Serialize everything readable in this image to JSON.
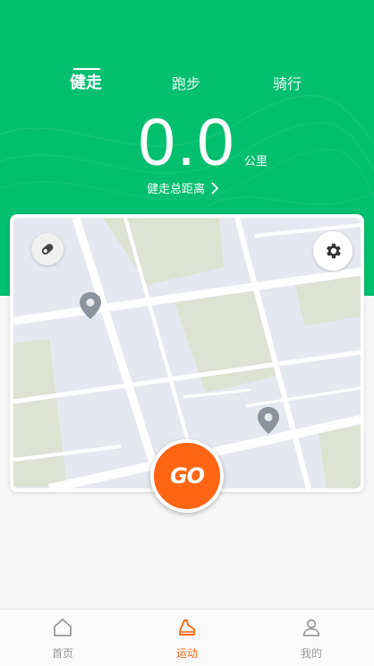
{
  "colors": {
    "brand_green": "#03bf6e",
    "accent_orange": "#ff6512",
    "tab_inactive": "#999999"
  },
  "mode_tabs": [
    {
      "label": "健走",
      "active": true
    },
    {
      "label": "跑步",
      "active": false
    },
    {
      "label": "骑行",
      "active": false
    }
  ],
  "summary": {
    "distance": "0.0",
    "unit": "公里",
    "link_label": "健走总距离"
  },
  "map": {
    "shoe_icon": "shoe-icon",
    "settings_icon": "gear-icon",
    "pin_icon": "location-pin-icon"
  },
  "go_button": {
    "label": "GO"
  },
  "tabbar": {
    "items": [
      {
        "label": "首页",
        "icon": "home-icon",
        "active": false
      },
      {
        "label": "运动",
        "icon": "sneaker-icon",
        "active": true
      },
      {
        "label": "我的",
        "icon": "user-icon",
        "active": false
      }
    ]
  }
}
